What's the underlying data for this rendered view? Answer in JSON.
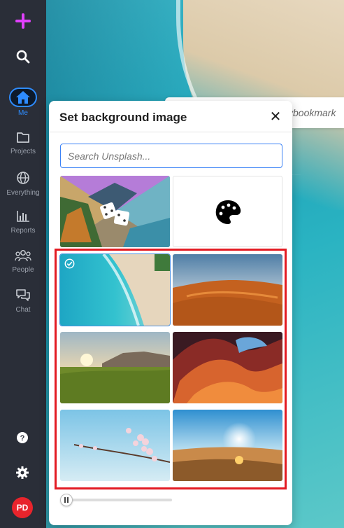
{
  "sidebar": {
    "add_icon": "plus-icon",
    "search_icon": "search-icon",
    "items": [
      {
        "label": "Me",
        "icon": "home-icon",
        "active": true
      },
      {
        "label": "Projects",
        "icon": "folder-icon"
      },
      {
        "label": "Everything",
        "icon": "globe-icon"
      },
      {
        "label": "Reports",
        "icon": "bar-chart-icon"
      },
      {
        "label": "People",
        "icon": "people-icon"
      },
      {
        "label": "Chat",
        "icon": "chat-icon"
      }
    ],
    "help_icon": "help-icon",
    "settings_icon": "gear-icon",
    "avatar_initials": "PD",
    "avatar_color": "#e8242c",
    "accent_color": "#2e8cff",
    "add_color": "#e040fb"
  },
  "background_tab": {
    "text": "ybookmark"
  },
  "modal": {
    "title": "Set background image",
    "close_label": "✕",
    "search_placeholder": "Search Unsplash...",
    "random_tile_icon": "dice-icon",
    "color_tile_icon": "palette-icon",
    "images": [
      {
        "name": "beach-aerial",
        "selected": true
      },
      {
        "name": "desert-dunes",
        "selected": false
      },
      {
        "name": "grassland-sunset",
        "selected": false
      },
      {
        "name": "antelope-canyon",
        "selected": false
      },
      {
        "name": "cherry-blossom",
        "selected": false
      },
      {
        "name": "desert-sunburst",
        "selected": false
      }
    ],
    "highlight_color": "#e31b23",
    "slider_value": 0
  }
}
